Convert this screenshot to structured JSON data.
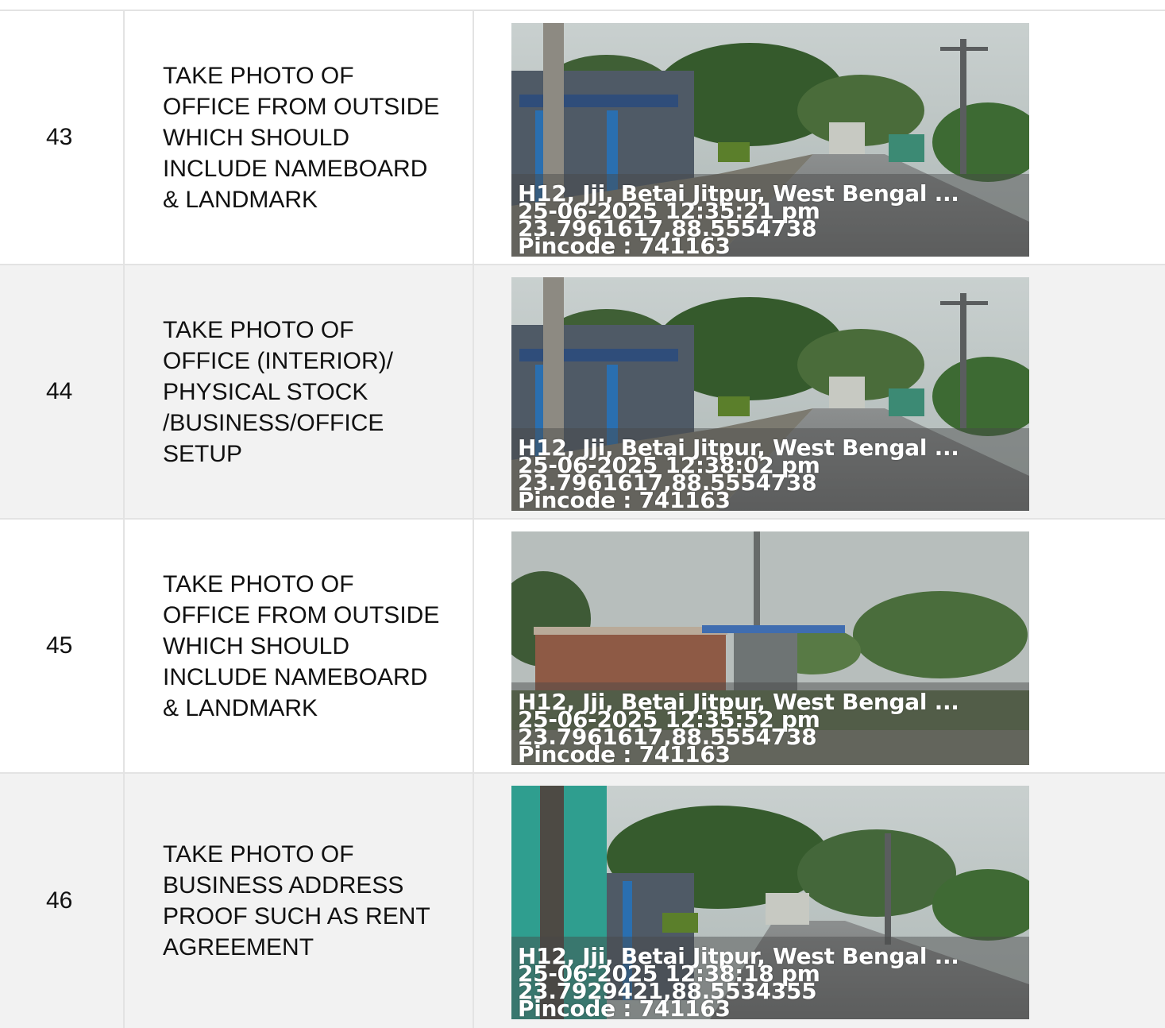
{
  "rows": [
    {
      "number": "43",
      "instruction_lines": [
        "TAKE PHOTO OF",
        "OFFICE FROM OUTSIDE",
        "WHICH SHOULD",
        "INCLUDE NAMEBOARD",
        "& LANDMARK"
      ],
      "photo": {
        "address": "H12, Jji, Betai Jitpur, West Bengal ...",
        "datetime": "25-06-2025 12:35:21 pm",
        "coordinates": "23.7961617,88.5554738",
        "pincode": "Pincode : 741163"
      }
    },
    {
      "number": "44",
      "instruction_lines": [
        "TAKE PHOTO OF",
        "OFFICE (INTERIOR)/",
        "PHYSICAL STOCK",
        "/BUSINESS/OFFICE",
        "SETUP"
      ],
      "photo": {
        "address": "H12, Jji, Betai Jitpur, West Bengal ...",
        "datetime": "25-06-2025 12:38:02 pm",
        "coordinates": "23.7961617,88.5554738",
        "pincode": "Pincode : 741163"
      }
    },
    {
      "number": "45",
      "instruction_lines": [
        "TAKE PHOTO OF",
        "OFFICE FROM OUTSIDE",
        "WHICH SHOULD",
        "INCLUDE NAMEBOARD",
        "& LANDMARK"
      ],
      "photo": {
        "address": "H12, Jji, Betai Jitpur, West Bengal ...",
        "datetime": "25-06-2025 12:35:52 pm",
        "coordinates": "23.7961617,88.5554738",
        "pincode": "Pincode : 741163"
      }
    },
    {
      "number": "46",
      "instruction_lines": [
        "TAKE PHOTO OF",
        "BUSINESS ADDRESS",
        "PROOF SUCH AS RENT",
        "AGREEMENT"
      ],
      "photo": {
        "address": "H12, Jji, Betai Jitpur, West Bengal ...",
        "datetime": "25-06-2025 12:38:18 pm",
        "coordinates": "23.7929421,88.5534355",
        "pincode": "Pincode : 741163"
      }
    }
  ]
}
